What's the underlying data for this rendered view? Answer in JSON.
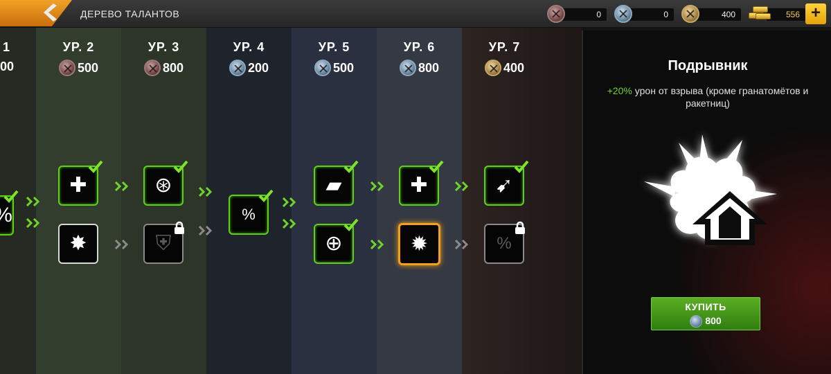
{
  "header": {
    "title": "ДЕРЕВО ТАЛАНТОВ",
    "currencies": [
      {
        "icon": "red-medal-icon",
        "value": "0"
      },
      {
        "icon": "blue-medal-icon",
        "value": "0"
      },
      {
        "icon": "gold-medal-icon",
        "value": "400"
      },
      {
        "icon": "gold-bars-icon",
        "value": "556"
      }
    ]
  },
  "columns": [
    {
      "level": "1",
      "cost": "00",
      "medal": "red"
    },
    {
      "level": "УР. 2",
      "cost": "500",
      "medal": "red"
    },
    {
      "level": "УР. 3",
      "cost": "800",
      "medal": "red"
    },
    {
      "level": "УР. 4",
      "cost": "200",
      "medal": "blue"
    },
    {
      "level": "УР. 5",
      "cost": "500",
      "medal": "blue"
    },
    {
      "level": "УР. 6",
      "cost": "800",
      "medal": "blue"
    },
    {
      "level": "УР. 7",
      "cost": "400",
      "medal": "gold"
    }
  ],
  "talents": [
    {
      "icon": "heart-percent-icon",
      "glyph": "%",
      "state": "bought"
    },
    {
      "icon": "head-medkit-icon",
      "glyph": "✚",
      "state": "bought"
    },
    {
      "icon": "shield-blast-icon",
      "glyph": "✸",
      "state": "available"
    },
    {
      "icon": "shield-cylinder-icon",
      "glyph": "⊛",
      "state": "bought"
    },
    {
      "icon": "shield-locked-icon",
      "glyph": "⛨",
      "state": "locked"
    },
    {
      "icon": "heart-percent-icon",
      "glyph": "%",
      "state": "bought"
    },
    {
      "icon": "ammo-shield-icon",
      "glyph": "▰",
      "state": "bought"
    },
    {
      "icon": "shield-crosshair-icon",
      "glyph": "⊕",
      "state": "bought"
    },
    {
      "icon": "medkit-upgrade-icon",
      "glyph": "✚",
      "state": "bought"
    },
    {
      "icon": "explosion-upgrade-icon",
      "glyph": "✹",
      "state": "selected"
    },
    {
      "icon": "bullet-impact-icon",
      "glyph": "➹",
      "state": "bought"
    },
    {
      "icon": "heart-percent-locked-icon",
      "glyph": "%",
      "state": "locked"
    }
  ],
  "detail": {
    "name": "Подрывник",
    "bonus": "+20%",
    "description": " урон от взрыва (кроме гранатомётов и ракетниц)",
    "buy_label": "КУПИТЬ",
    "buy_cost": "800",
    "buy_medal": "blue"
  },
  "colors": {
    "accent_orange": "#f3a11c",
    "bought_green": "#5fcf19",
    "buy_button": "#4a9e1d"
  }
}
